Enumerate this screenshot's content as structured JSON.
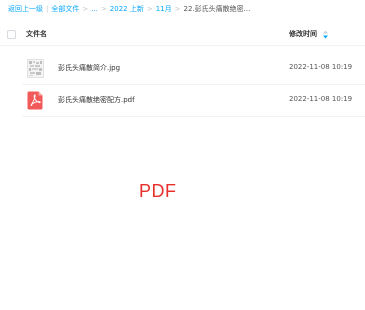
{
  "breadcrumb": {
    "back": "返回上一级",
    "items": [
      "全部文件",
      "...",
      "2022 上新",
      "11月"
    ],
    "current": "22.彭氏头痛散绝密...",
    "separator_main": "|",
    "separator": ">"
  },
  "table": {
    "header_name": "文件名",
    "header_time": "修改时间",
    "rows": [
      {
        "icon": "image-thumbnail-icon",
        "name": "彭氏头痛散简介.jpg",
        "time": "2022-11-08 10:19"
      },
      {
        "icon": "pdf-file-icon",
        "name": "彭氏头痛散绝密配方.pdf",
        "time": "2022-11-08 10:19"
      }
    ]
  },
  "preview": {
    "label": "PDF"
  },
  "colors": {
    "link": "#06a7ff",
    "pdf": "#f25a5a",
    "preview_text": "#e8302a"
  }
}
